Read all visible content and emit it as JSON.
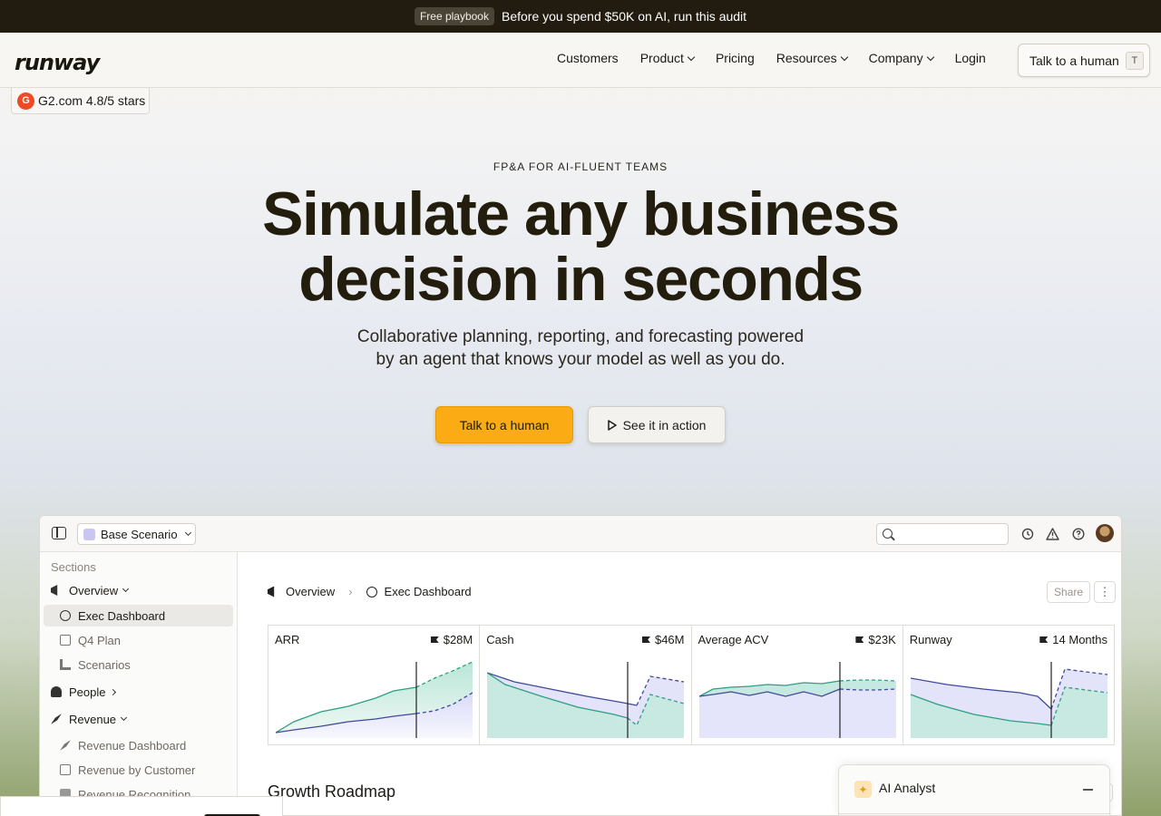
{
  "banner": {
    "pill": "Free playbook",
    "message": "Before you spend $50K on AI, run this audit"
  },
  "nav": {
    "logo": "runway",
    "links": [
      {
        "label": "Customers",
        "dropdown": false
      },
      {
        "label": "Product",
        "dropdown": true
      },
      {
        "label": "Pricing",
        "dropdown": false
      },
      {
        "label": "Resources",
        "dropdown": true
      },
      {
        "label": "Company",
        "dropdown": true
      },
      {
        "label": "Login",
        "dropdown": false
      }
    ],
    "cta": "Talk to a human",
    "cta_shortcut": "T"
  },
  "badge": {
    "logo": "G",
    "text": "G2.com 4.8/5 stars"
  },
  "hero": {
    "eyebrow": "FP&A FOR AI-FLUENT TEAMS",
    "headline_line1": "Simulate any business",
    "headline_line2": "decision in seconds",
    "subhead_line1": "Collaborative planning, reporting, and forecasting powered",
    "subhead_line2": "by an agent that knows your model as well as you do.",
    "primary_button": "Talk to a human",
    "secondary_button": "See it in action"
  },
  "app": {
    "scenario": "Base Scenario",
    "sidebar": {
      "title": "Sections",
      "items": [
        {
          "label": "Overview",
          "kind": "group",
          "expanded": true
        },
        {
          "label": "Exec Dashboard",
          "kind": "sub",
          "active": true
        },
        {
          "label": "Q4 Plan",
          "kind": "sub"
        },
        {
          "label": "Scenarios",
          "kind": "sub"
        },
        {
          "label": "People",
          "kind": "group",
          "expanded": false
        },
        {
          "label": "Revenue",
          "kind": "group",
          "expanded": true
        },
        {
          "label": "Revenue Dashboard",
          "kind": "sub"
        },
        {
          "label": "Revenue by Customer",
          "kind": "sub"
        },
        {
          "label": "Revenue Recognition",
          "kind": "sub"
        }
      ]
    },
    "breadcrumb": [
      "Overview",
      "Exec Dashboard"
    ],
    "share": "Share",
    "section_heading": "Growth Roadmap",
    "analyst_title": "AI Analyst"
  },
  "metrics": [
    {
      "label": "ARR",
      "value": "$28M"
    },
    {
      "label": "Cash",
      "value": "$46M"
    },
    {
      "label": "Average ACV",
      "value": "$23K"
    },
    {
      "label": "Runway",
      "value": "14 Months"
    }
  ],
  "colors": {
    "banner_bg": "#221c10",
    "accent": "#fbab13",
    "green": "#2f9e83",
    "blue": "#3f4a9a"
  },
  "icons": [
    "g2-logo",
    "sidebar-toggle-icon",
    "scenario-icon",
    "search-icon",
    "history-icon",
    "warning-icon",
    "help-icon",
    "play-icon",
    "megaphone-icon",
    "dashboard-icon",
    "flag-icon",
    "sparkle-icon"
  ]
}
